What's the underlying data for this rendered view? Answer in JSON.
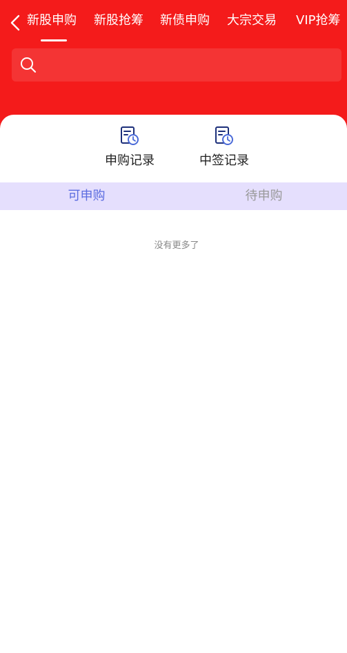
{
  "header": {
    "tabs": [
      {
        "label": "新股申购",
        "active": true
      },
      {
        "label": "新股抢筹",
        "active": false
      },
      {
        "label": "新债申购",
        "active": false
      },
      {
        "label": "大宗交易",
        "active": false
      },
      {
        "label": "VIP抢筹",
        "active": false
      }
    ]
  },
  "search": {
    "value": "",
    "placeholder": ""
  },
  "records": {
    "subscribe_label": "申购记录",
    "winning_label": "中签记录"
  },
  "subtabs": {
    "available": "可申购",
    "pending": "待申购"
  },
  "list": {
    "empty_text": "没有更多了"
  },
  "colors": {
    "header_bg": "#f41b1b",
    "accent": "#5b6ce0",
    "subtab_bg": "#e5dffd"
  }
}
